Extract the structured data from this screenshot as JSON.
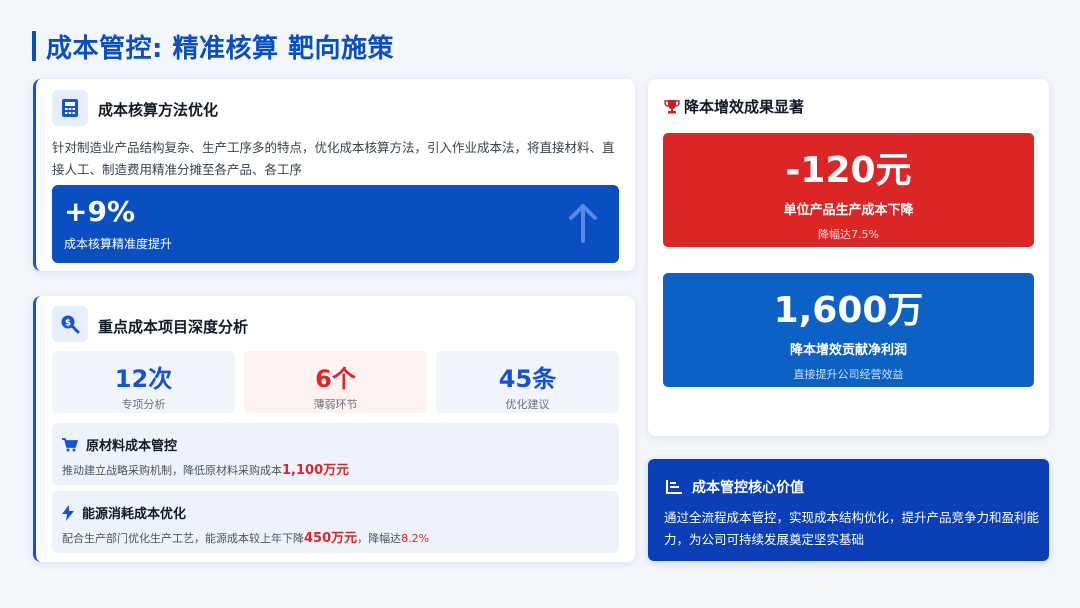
{
  "page": {
    "title": "成本管控: 精准核算 靶向施策"
  },
  "method_card": {
    "heading": "成本核算方法优化",
    "icon": "calculator-icon",
    "description": "针对制造业产品结构复杂、生产工序多的特点，优化成本核算方法，引入作业成本法，将直接材料、直接人工、制造费用精准分摊至各产品、各工序",
    "banner_value": "+9%",
    "banner_label": "成本核算精准度提升",
    "banner_icon": "arrow-up-icon"
  },
  "analysis_card": {
    "heading": "重点成本项目深度分析",
    "icon": "search-dollar-icon",
    "stats": [
      {
        "value": "12次",
        "label": "专项分析",
        "color": "#1553d6"
      },
      {
        "value": "6个",
        "label": "薄弱环节",
        "color": "#dc2626"
      },
      {
        "value": "45条",
        "label": "优化建议",
        "color": "#1553d6"
      }
    ],
    "items": [
      {
        "title": "原材料成本管控",
        "icon": "cart-icon",
        "text": "推动建立战略采购机制，降低原材料采购成本",
        "highlight": "1,100万元"
      },
      {
        "title": "能源消耗成本优化",
        "icon": "bolt-icon",
        "text": "配合生产部门优化生产工艺，能源成本较上年下降",
        "highlight": "450万元",
        "text2": "，降幅达",
        "highlight2": "8.2%"
      }
    ]
  },
  "results_card": {
    "heading": "降本增效成果显著",
    "icon": "trophy-icon",
    "kpis": [
      {
        "value": "-120元",
        "label": "单位产品生产成本下降",
        "sub": "降幅达7.5%",
        "color": "#dc2626"
      },
      {
        "value": "1,600万",
        "label": "降本增效贡献净利润",
        "sub": "直接提升公司经营效益",
        "color": "#0b62c4"
      }
    ]
  },
  "value_card": {
    "heading": "成本管控核心价值",
    "icon": "list-icon",
    "text": "通过全流程成本管控，实现成本结构优化，提升产品竞争力和盈利能力，为公司可持续发展奠定坚实基础"
  },
  "colors": {
    "brand": "#0a4fc2",
    "danger": "#dc2626",
    "kpi_blue": "#0b62c4"
  }
}
